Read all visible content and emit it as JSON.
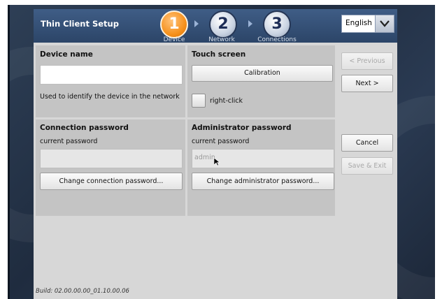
{
  "app_title": "Thin Client Setup",
  "steps": [
    {
      "number": "1",
      "label": "Device",
      "active": true
    },
    {
      "number": "2",
      "label": "Network",
      "active": false
    },
    {
      "number": "3",
      "label": "Connections",
      "active": false
    }
  ],
  "language": {
    "selected": "English",
    "icon": "chevron-down-icon"
  },
  "device_name": {
    "title": "Device name",
    "value": "",
    "description": "Used to identify the device in the network"
  },
  "touch_screen": {
    "title": "Touch screen",
    "calibration_label": "Calibration",
    "right_click_label": "right-click",
    "right_click_checked": false
  },
  "connection_password": {
    "title": "Connection password",
    "current_label": "current password",
    "current_value": "",
    "change_button": "Change connection password..."
  },
  "admin_password": {
    "title": "Administrator password",
    "current_label": "current password",
    "current_value": "admin",
    "change_button": "Change administrator password..."
  },
  "nav": {
    "previous": "< Previous",
    "next": "Next >",
    "cancel": "Cancel",
    "save_exit": "Save & Exit"
  },
  "build": "Build: 02.00.00.00_01.10.00.06",
  "colors": {
    "accent_orange": "#f6921e",
    "header_blue": "#34517a",
    "panel_gray": "#c4c4c4"
  }
}
